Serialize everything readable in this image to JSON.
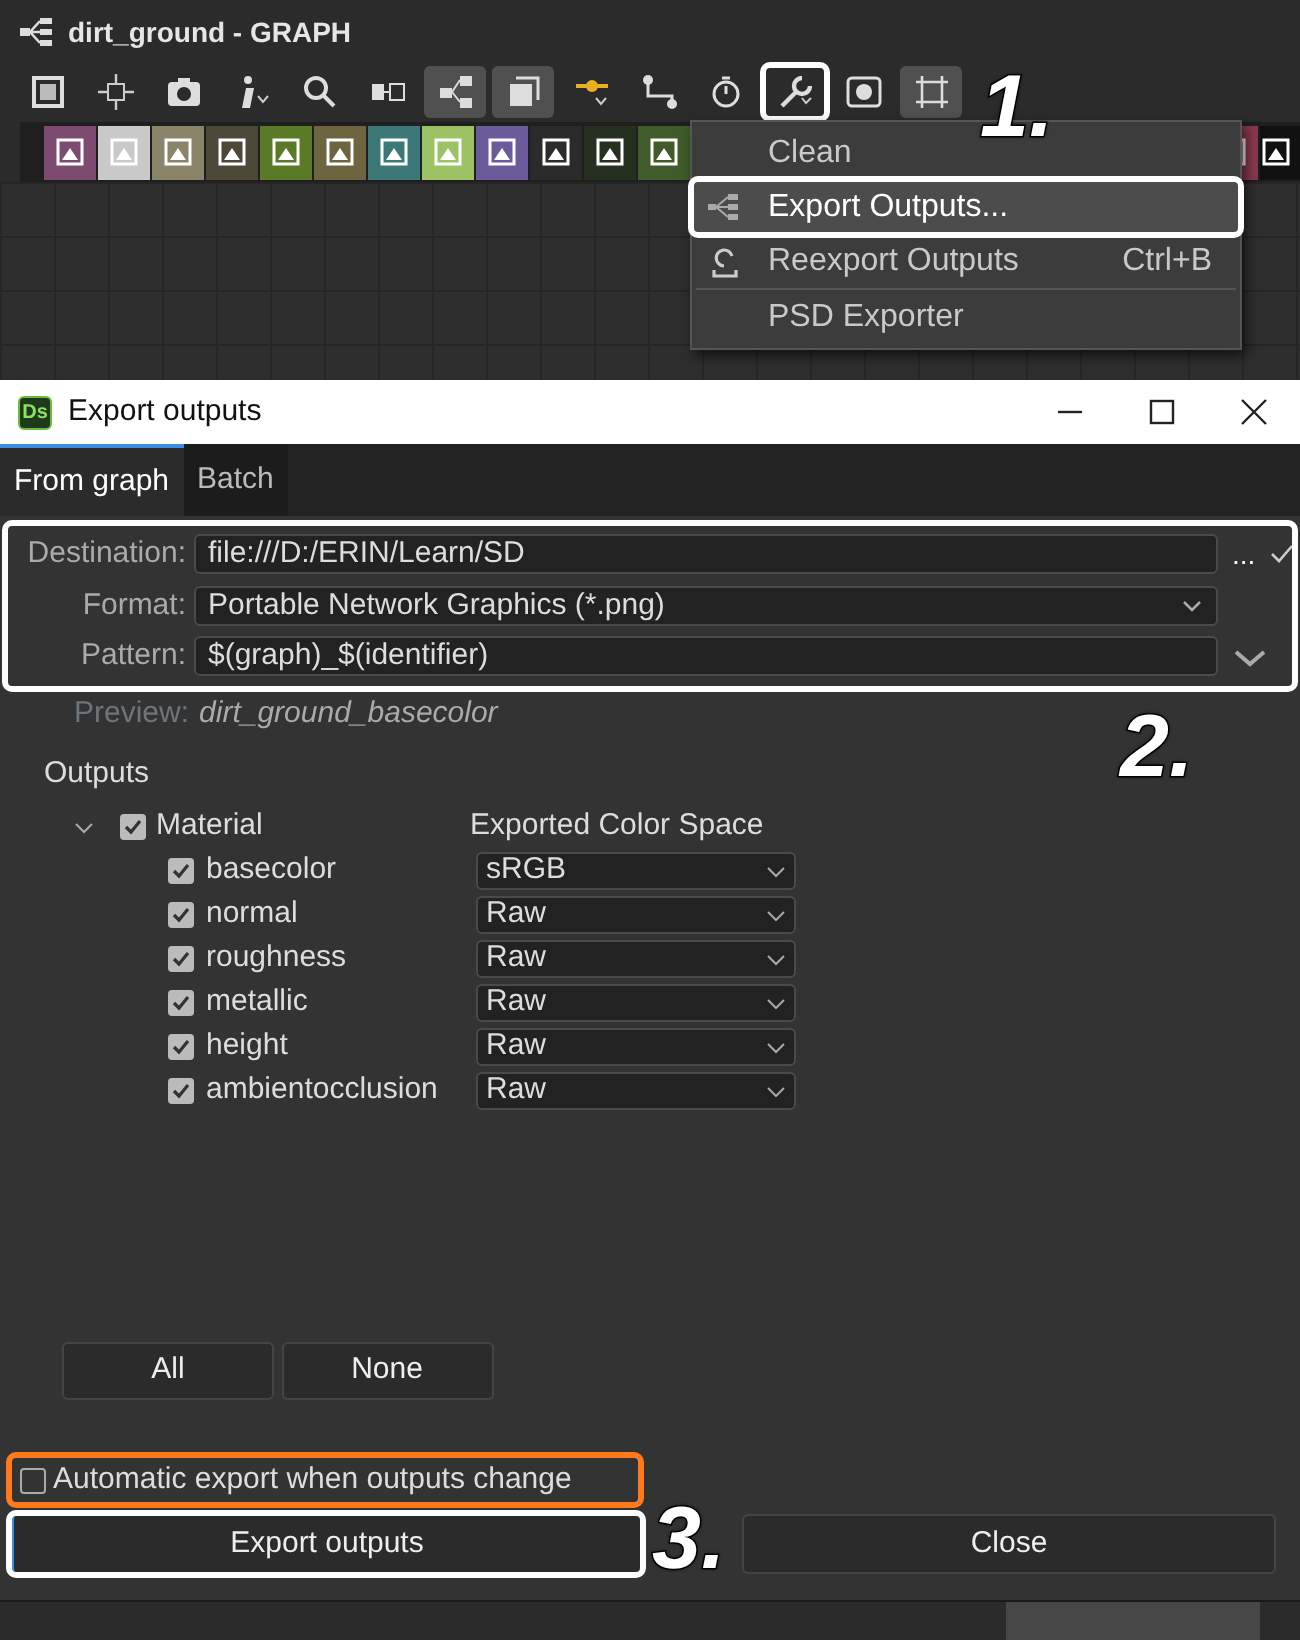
{
  "graph_panel": {
    "title": "dirt_ground - GRAPH",
    "toolbar": [
      {
        "kind": "frame",
        "selected": false,
        "callout": false
      },
      {
        "kind": "fit",
        "selected": false,
        "callout": false
      },
      {
        "kind": "camera",
        "selected": false,
        "callout": false
      },
      {
        "kind": "info",
        "selected": false,
        "callout": false
      },
      {
        "kind": "search",
        "selected": false,
        "callout": false
      },
      {
        "kind": "align",
        "selected": false,
        "callout": false
      },
      {
        "kind": "hierarchy",
        "selected": true,
        "callout": false
      },
      {
        "kind": "layers",
        "selected": true,
        "callout": false
      },
      {
        "kind": "pin",
        "selected": false,
        "callout": false
      },
      {
        "kind": "link",
        "selected": false,
        "callout": false
      },
      {
        "kind": "timer",
        "selected": false,
        "callout": false
      },
      {
        "kind": "wrench",
        "selected": false,
        "callout": true
      },
      {
        "kind": "preview",
        "selected": false,
        "callout": false
      },
      {
        "kind": "crop",
        "selected": true,
        "callout": false
      }
    ],
    "node_library": [
      {
        "color": "#7d4b70"
      },
      {
        "color": "#c9c9c9"
      },
      {
        "color": "#8a8568"
      },
      {
        "color": "#4e4838"
      },
      {
        "color": "#5a7a27"
      },
      {
        "color": "#6d6540"
      },
      {
        "color": "#3d7878"
      },
      {
        "color": "#9cc264"
      },
      {
        "color": "#6b5b9b"
      },
      {
        "color": "#2b2b2b"
      },
      {
        "color": "#263020"
      },
      {
        "color": "#3f5c2a"
      }
    ],
    "node_library_end": [
      {
        "color": "#8a3a4e"
      },
      {
        "color": "#111111"
      }
    ],
    "menu": [
      {
        "kind": "plain",
        "label": "Clean",
        "highlighted": false,
        "callout": false
      },
      {
        "kind": "export",
        "label": "Export Outputs...",
        "highlighted": true,
        "callout": true
      },
      {
        "kind": "reexport",
        "label": "Reexport Outputs",
        "shortcut": "Ctrl+B",
        "highlighted": false,
        "callout": false
      },
      {
        "kind": "plain",
        "label": "PSD Exporter",
        "highlighted": false,
        "callout": false
      }
    ]
  },
  "dialog": {
    "title": "Export outputs",
    "app_badge": "Ds",
    "tabs": [
      {
        "label": "From graph",
        "selected": true
      },
      {
        "label": "Batch",
        "selected": false
      }
    ],
    "settings_callout": true,
    "destination": {
      "label": "Destination:",
      "value": "file:///D:/ERIN/Learn/SD",
      "browse": "..."
    },
    "format": {
      "label": "Format:",
      "value": "Portable Network Graphics (*.png)"
    },
    "pattern": {
      "label": "Pattern:",
      "value": "$(graph)_$(identifier)"
    },
    "preview": {
      "label": "Preview:",
      "value": "dirt_ground_basecolor"
    },
    "outputs_label": "Outputs",
    "tree": {
      "label": "Material",
      "checked": true,
      "expanded": true,
      "column_header": "Exported Color Space",
      "children": [
        {
          "name": "basecolor",
          "checked": true,
          "color_space": "sRGB"
        },
        {
          "name": "normal",
          "checked": true,
          "color_space": "Raw"
        },
        {
          "name": "roughness",
          "checked": true,
          "color_space": "Raw"
        },
        {
          "name": "metallic",
          "checked": true,
          "color_space": "Raw"
        },
        {
          "name": "height",
          "checked": true,
          "color_space": "Raw"
        },
        {
          "name": "ambientocclusion",
          "checked": true,
          "color_space": "Raw"
        }
      ]
    },
    "select_buttons": [
      "All",
      "None"
    ],
    "auto_export": {
      "label": "Automatic export when outputs change",
      "checked": false,
      "callout": true
    },
    "actions": [
      {
        "label": "Export outputs",
        "focused": true,
        "callout": true
      },
      {
        "label": "Close",
        "focused": false,
        "callout": false
      }
    ]
  },
  "annotations": [
    {
      "label": "1."
    },
    {
      "label": "2."
    },
    {
      "label": "3."
    }
  ]
}
